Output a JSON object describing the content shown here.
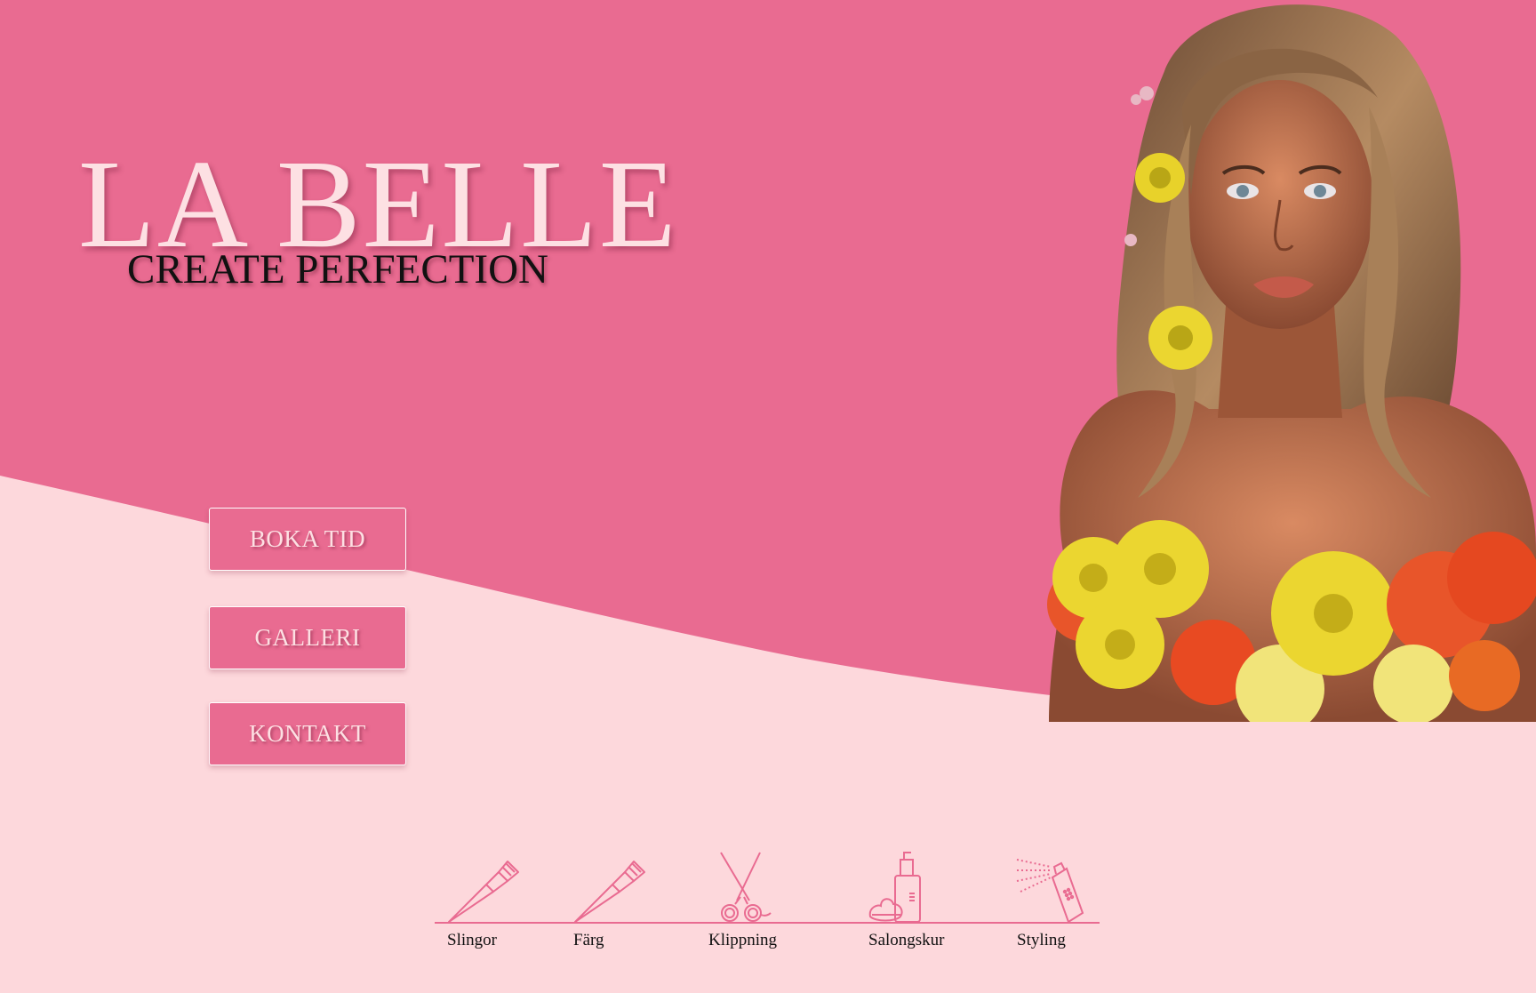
{
  "brand": {
    "title": "LA BELLE",
    "tagline": "CREATE PERFECTION"
  },
  "nav": {
    "boka_tid": "BOKA TID",
    "galleri": "GALLERI",
    "kontakt": "KONTAKT"
  },
  "services": [
    {
      "label": "Slingor",
      "icon": "tint-brush-icon"
    },
    {
      "label": "Färg",
      "icon": "tint-brush-icon"
    },
    {
      "label": "Klippning",
      "icon": "scissors-icon"
    },
    {
      "label": "Salongskur",
      "icon": "mousse-bottle-icon"
    },
    {
      "label": "Styling",
      "icon": "hairspray-icon"
    }
  ],
  "colors": {
    "primary_pink": "#e96b91",
    "light_pink": "#fdd8dc",
    "title_pink": "#fde0e3",
    "text_dark": "#111111"
  }
}
